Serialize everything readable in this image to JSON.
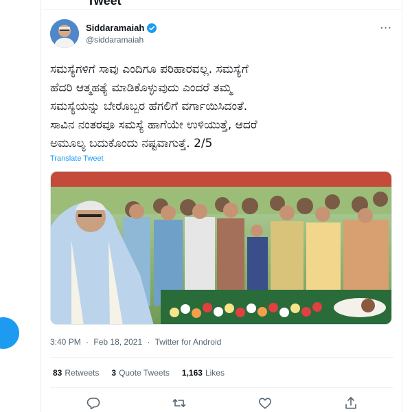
{
  "header": {
    "title": "Tweet"
  },
  "tweet": {
    "author": {
      "display_name": "Siddaramaiah",
      "handle": "@siddaramaiah",
      "verified": true,
      "avatar": "avatar"
    },
    "text_lines": [
      "ಸಮಸ್ಯೆಗಳಿಗೆ ಸಾವು ಎಂದಿಗೂ ಪರಿಹಾರವಲ್ಲ. ಸಮಸ್ಯೆಗೆ",
      "ಹೆದರಿ ಆತ್ಮಹತ್ಯೆ ಮಾಡಿಕೊಳ್ಳುವುದು ಎಂದರೆ ತಮ್ಮ",
      "ಸಮಸ್ಯೆಯನ್ನು ಬೇರೊಬ್ಬರ ಹೆಗಲಿಗೆ ವರ್ಗಾಯಿಸಿದಂತೆ.",
      "ಸಾವಿನ ನಂತರವೂ ಸಮಸ್ಯೆ ಹಾಗೆಯೇ ಉಳಿಯುತ್ತೆ, ಆದರೆ",
      "ಅಮೂಲ್ಯ ಬದುಕೊಂದು ನಷ್ಟವಾಗುತ್ತೆ. 2/5"
    ],
    "translate_label": "Translate Tweet",
    "media": {
      "description": "photo"
    },
    "time": "3:40 PM",
    "date": "Feb 18, 2021",
    "source": "Twitter for Android",
    "separator": "·",
    "stats": {
      "retweets_count": "83",
      "retweets_label": "Retweets",
      "quote_count": "3",
      "quote_label": "Quote Tweets",
      "likes_count": "1,163",
      "likes_label": "Likes"
    },
    "actions": [
      "reply-icon",
      "retweet-icon",
      "like-icon",
      "share-icon"
    ]
  },
  "colors": {
    "accent": "#1d9bf0",
    "text": "#0f1419",
    "secondary": "#536471",
    "border": "#eff3f4"
  }
}
